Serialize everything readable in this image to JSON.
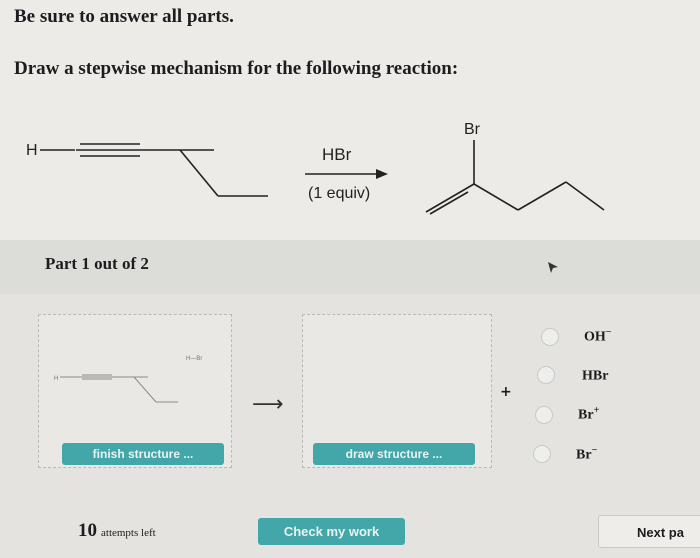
{
  "instructions": {
    "line1": "Be sure to answer all parts.",
    "line2": "Draw a stepwise mechanism for the following reaction:"
  },
  "reaction": {
    "reactant_h": "H",
    "reagent": "HBr",
    "condition": "(1 equiv)",
    "product_br": "Br"
  },
  "part": {
    "label": "Part 1 out of 2"
  },
  "workspace": {
    "finish_button": "finish structure ...",
    "draw_button": "draw structure ...",
    "mini_h_br": "H—Br",
    "mini_h": "H",
    "plus": "+"
  },
  "options": [
    {
      "label": "OH",
      "sup": "−"
    },
    {
      "label": "HBr",
      "sup": ""
    },
    {
      "label": "Br",
      "sup": "+"
    },
    {
      "label": "Br",
      "sup": "−"
    }
  ],
  "footer": {
    "attempts_num": "10",
    "attempts_text": "attempts left",
    "check_button": "Check my work",
    "next_button": "Next pa"
  }
}
